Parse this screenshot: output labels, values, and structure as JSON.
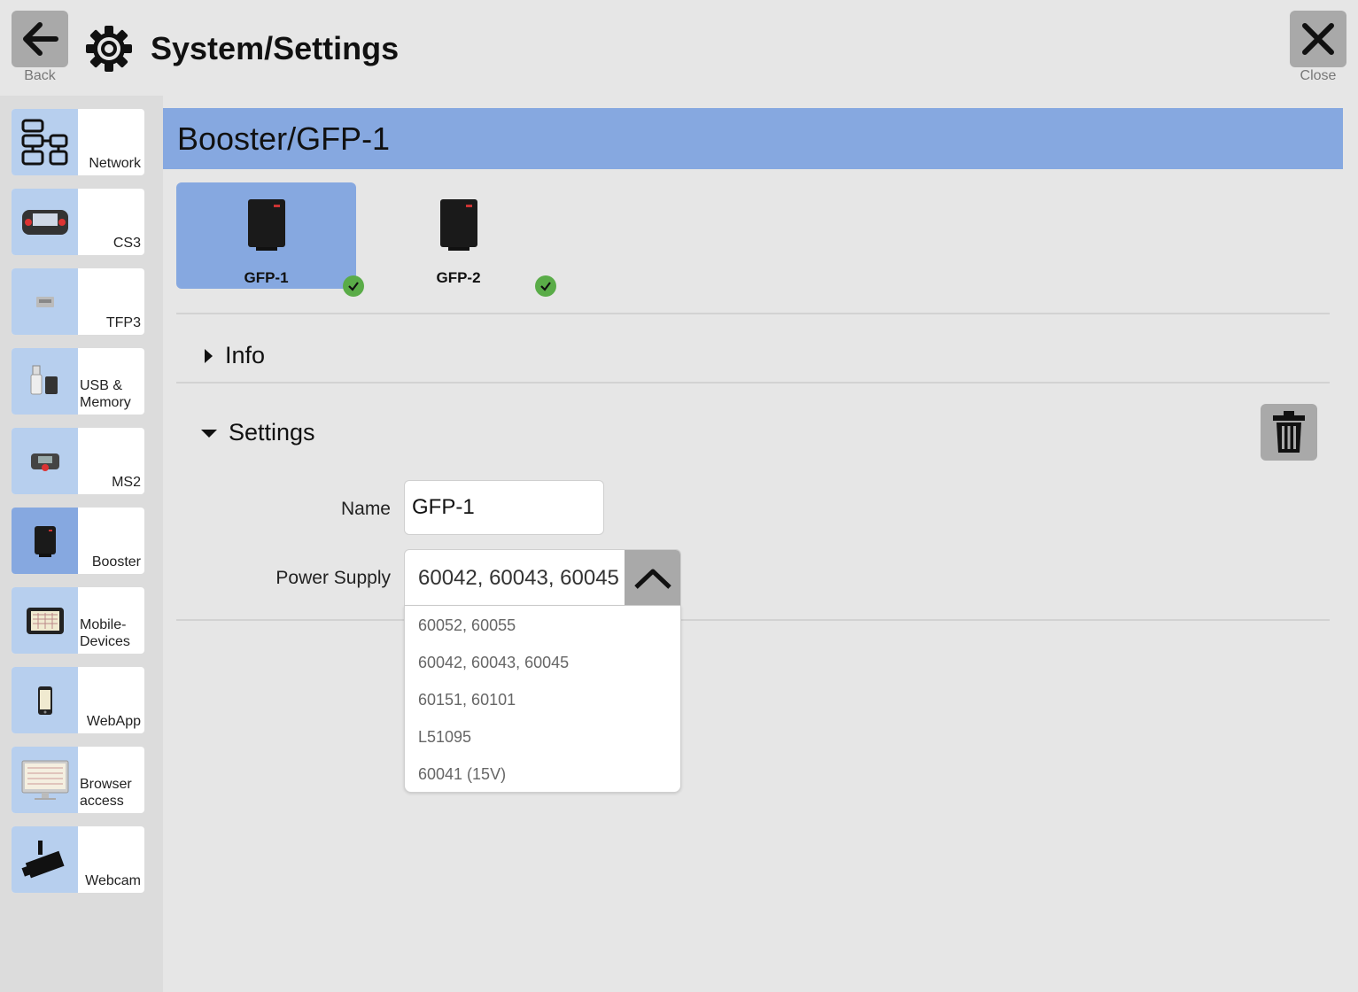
{
  "header": {
    "title": "System/Settings",
    "back_label": "Back",
    "close_label": "Close"
  },
  "sidebar": {
    "items": [
      {
        "label": "Network",
        "icon": "network-icon"
      },
      {
        "label": "CS3",
        "icon": "cs3-device-icon"
      },
      {
        "label": "TFP3",
        "icon": "tfp3-device-icon"
      },
      {
        "label": "USB & Memory",
        "icon": "usb-memory-icon"
      },
      {
        "label": "MS2",
        "icon": "ms2-device-icon"
      },
      {
        "label": "Booster",
        "icon": "booster-device-icon",
        "active": true
      },
      {
        "label": "Mobile-Devices",
        "icon": "tablet-icon"
      },
      {
        "label": "WebApp",
        "icon": "smartphone-icon"
      },
      {
        "label": "Browser access",
        "icon": "monitor-icon"
      },
      {
        "label": "Webcam",
        "icon": "webcam-icon"
      }
    ]
  },
  "panel": {
    "title": "Booster/GFP-1",
    "devices": [
      {
        "name": "GFP-1",
        "selected": true,
        "status": "ok"
      },
      {
        "name": "GFP-2",
        "selected": false,
        "status": "ok"
      }
    ],
    "info_section": {
      "label": "Info",
      "expanded": false
    },
    "settings_section": {
      "label": "Settings",
      "expanded": true
    },
    "name_field": {
      "label": "Name",
      "value": "GFP-1"
    },
    "power_supply": {
      "label": "Power Supply",
      "value": "60042, 60043, 60045",
      "options": [
        "60052, 60055",
        "60042, 60043, 60045",
        "60151, 60101",
        "L51095",
        "60041 (15V)"
      ]
    }
  },
  "colors": {
    "accent": "#86a8e0",
    "sidebar_icon_bg": "#b7cfee",
    "button_gray": "#a9a9a9",
    "status_ok": "#5aac48"
  }
}
